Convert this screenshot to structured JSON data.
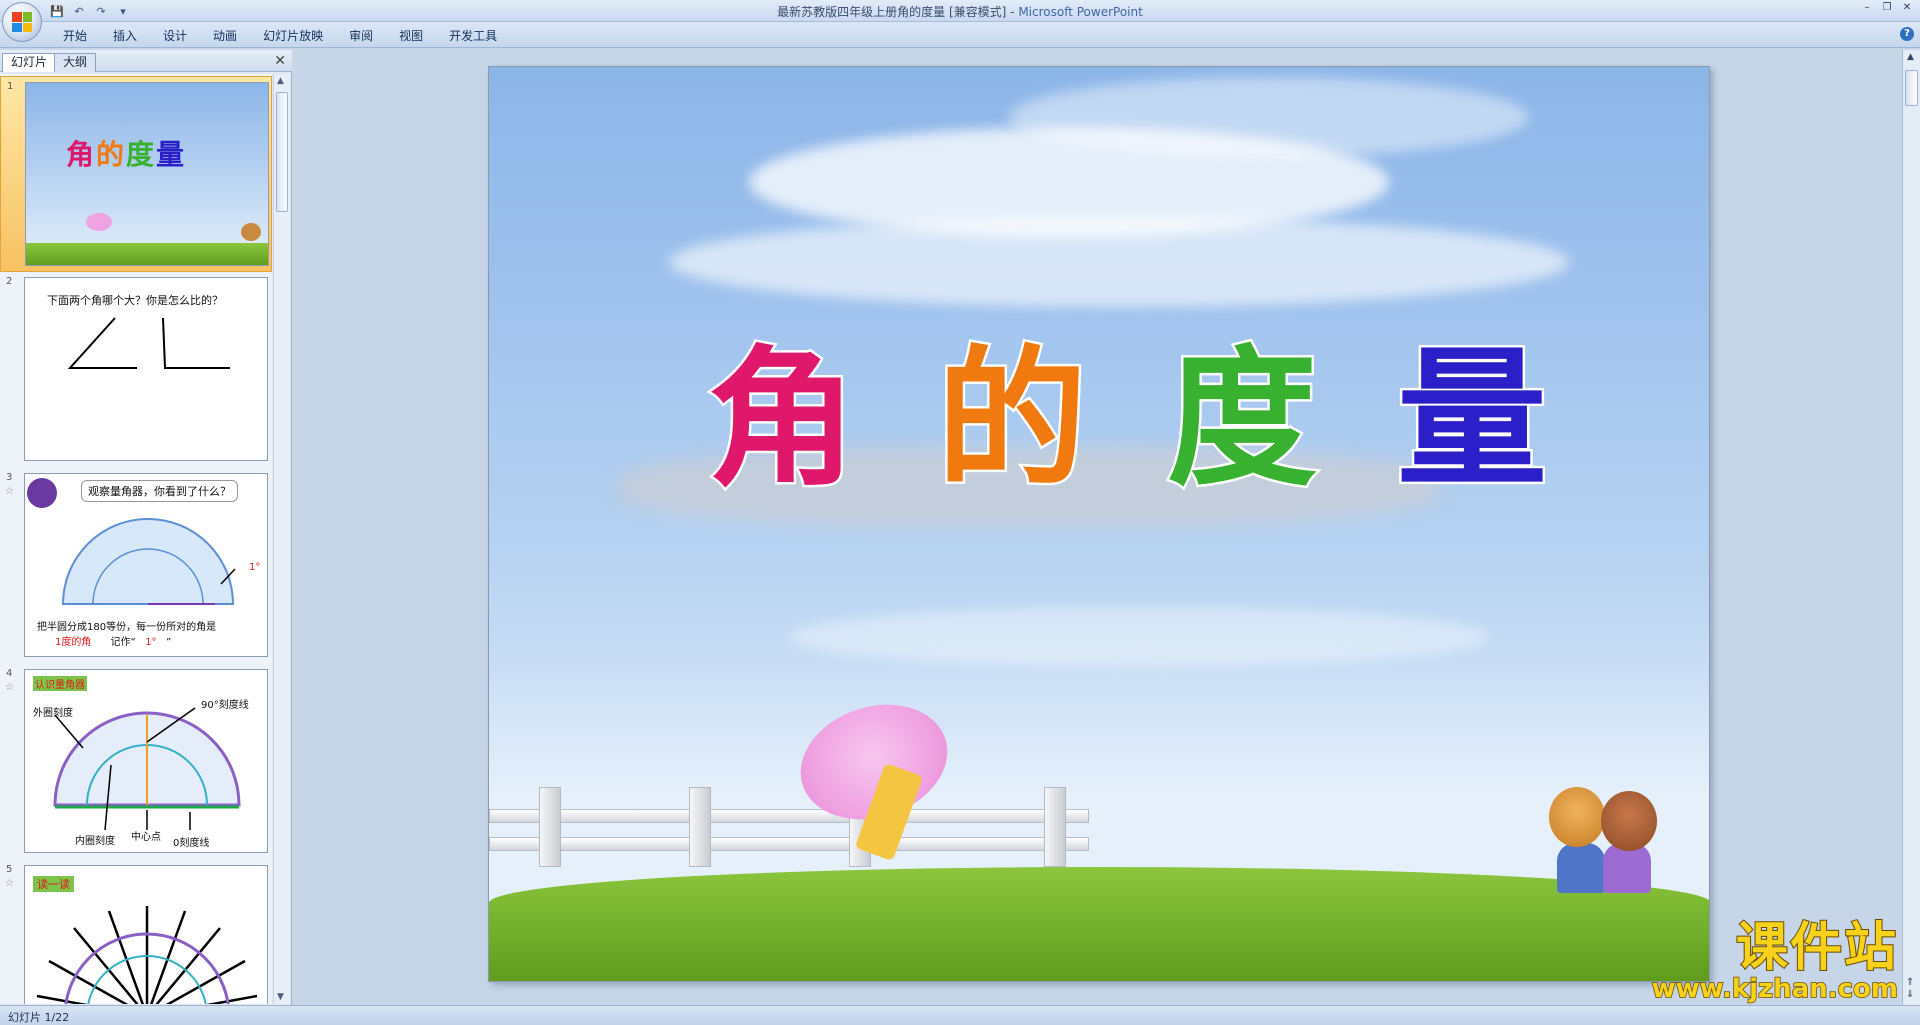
{
  "window": {
    "title_doc": "最新苏教版四年级上册角的度量 [兼容模式]",
    "title_sep": " - ",
    "title_app": "Microsoft PowerPoint"
  },
  "ribbon": {
    "tabs": [
      "开始",
      "插入",
      "设计",
      "动画",
      "幻灯片放映",
      "审阅",
      "视图",
      "开发工具"
    ]
  },
  "leftpanel": {
    "tab_slides": "幻灯片",
    "tab_outline": "大纲"
  },
  "slides": [
    {
      "num": "1",
      "title": "角的度量"
    },
    {
      "num": "2",
      "text": "下面两个角哪个大？你是怎么比的？"
    },
    {
      "num": "3",
      "bubble": "观察量角器，你看到了什么？",
      "label_1deg": "1°",
      "caption_a": "把半圆分成180等份，每一份所对的角是",
      "caption_red": "1度的角",
      "caption_b": "记作“",
      "caption_val": "1°",
      "caption_c": "”"
    },
    {
      "num": "4",
      "tag": "认识量角器",
      "label_outer": "外圈刻度",
      "label_90": "90°刻度线",
      "label_inner": "内圈刻度",
      "label_center": "中心点",
      "label_zero": "0刻度线"
    },
    {
      "num": "5",
      "tag": "读一读"
    }
  ],
  "main_slide": {
    "title_chars": [
      "角",
      "的",
      "度",
      "量"
    ],
    "title_colors": [
      "#e0186c",
      "#f07a10",
      "#38b030",
      "#2a1fc8"
    ]
  },
  "statusbar": {
    "slide_info": "幻灯片 1/22"
  },
  "site_logo": {
    "name": "课件站",
    "url": "www.kjzhan.com"
  }
}
